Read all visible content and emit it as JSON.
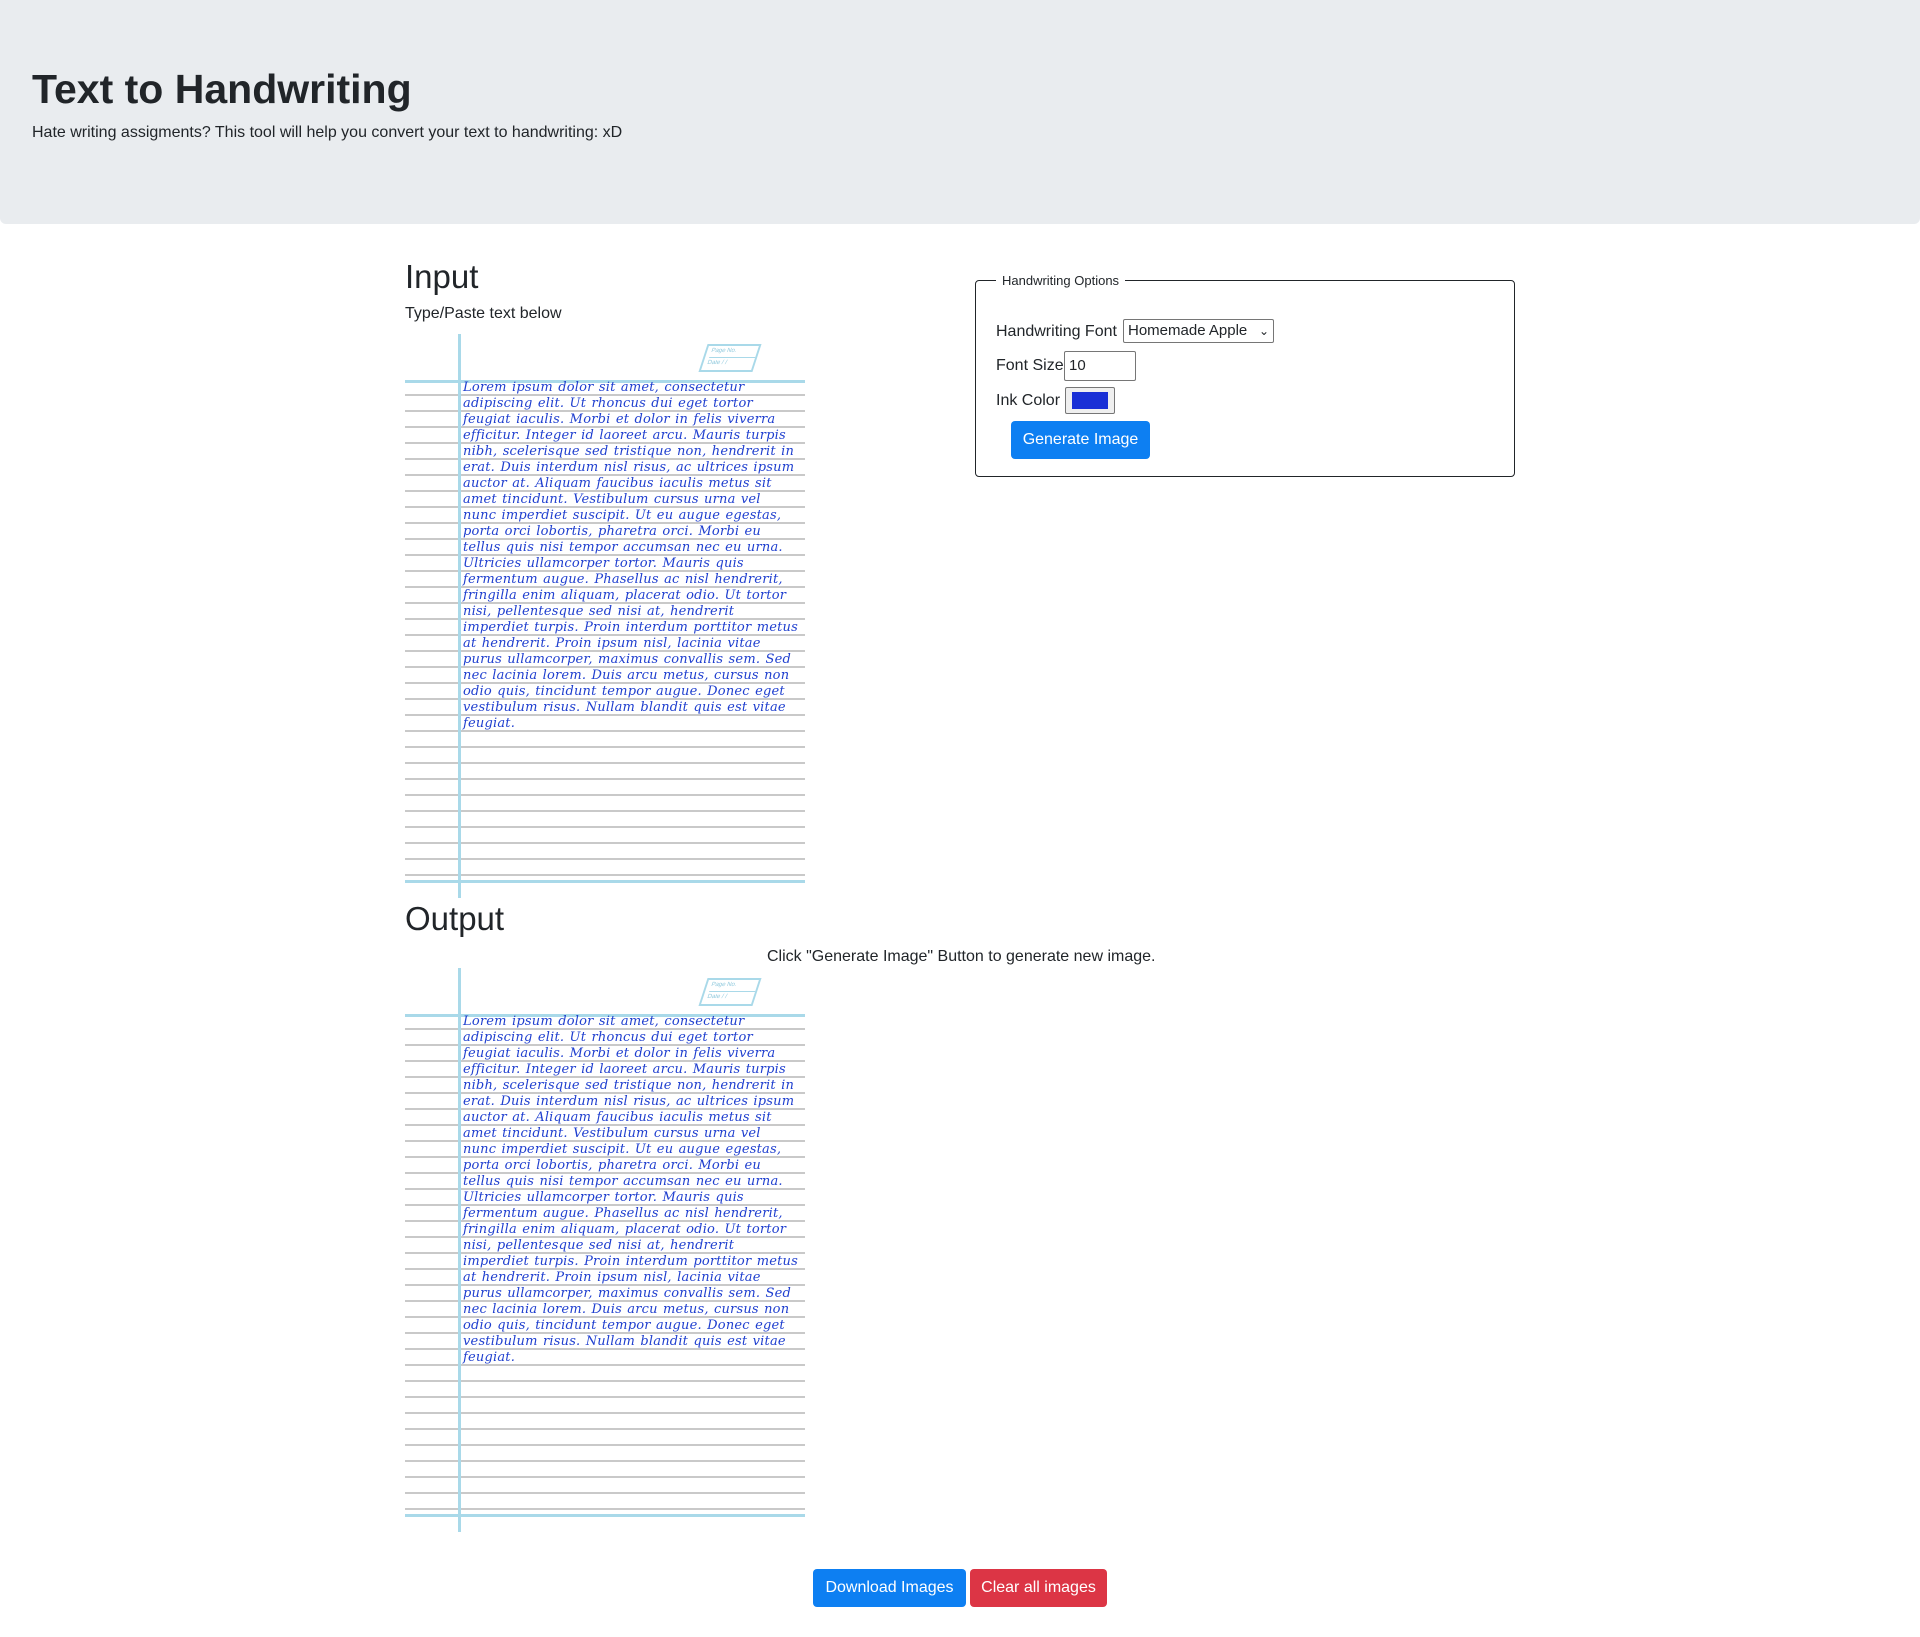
{
  "header": {
    "title": "Text to Handwriting",
    "subtitle": "Hate writing assigments? This tool will help you convert your text to handwriting: xD"
  },
  "input": {
    "heading": "Input",
    "hint": "Type/Paste text below"
  },
  "paper": {
    "page_label": "Page No.",
    "date_label": "Date",
    "date_value": "/   /",
    "text": "Lorem ipsum dolor sit amet, consectetur adipiscing elit. Ut rhoncus dui eget tortor feugiat iaculis. Morbi et dolor in felis viverra efficitur. Integer id laoreet arcu. Mauris turpis nibh, scelerisque sed tristique non, hendrerit in erat. Duis interdum nisl risus, ac ultrices ipsum auctor at. Aliquam faucibus iaculis metus sit amet tincidunt. Vestibulum cursus urna vel nunc imperdiet suscipit. Ut eu augue egestas, porta orci lobortis, pharetra orci. Morbi eu tellus quis nisi tempor accumsan nec eu urna. Ultricies ullamcorper tortor. Mauris quis fermentum augue. Phasellus ac nisl hendrerit, fringilla enim aliquam, placerat odio. Ut tortor nisi, pellentesque sed nisi at, hendrerit imperdiet turpis. Proin interdum porttitor metus at hendrerit. Proin ipsum nisl, lacinia vitae purus ullamcorper, maximus convallis sem. Sed nec lacinia lorem. Duis arcu metus, cursus non odio quis, tincidunt tempor augue. Donec eget vestibulum risus. Nullam blandit quis est vitae feugiat."
  },
  "options": {
    "legend": "Handwriting Options",
    "font_label": "Handwriting Font",
    "font_value": "Homemade Apple",
    "size_label": "Font Size",
    "size_value": "10",
    "ink_label": "Ink Color",
    "ink_color": "#1a30d6",
    "generate_label": "Generate Image"
  },
  "output": {
    "heading": "Output",
    "hint": "Click \"Generate Image\" Button to generate new image."
  },
  "actions": {
    "download_label": "Download Images",
    "clear_label": "Clear all images"
  },
  "colors": {
    "primary": "#0d7ff2",
    "danger": "#dc3545",
    "jumbotron": "#e9ecef",
    "ink": "#1f3fcf",
    "paper_rule": "#a9d9e9"
  }
}
